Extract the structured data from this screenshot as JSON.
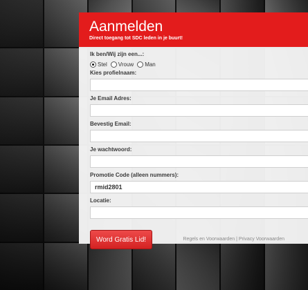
{
  "header": {
    "title": "Aanmelden",
    "subtitle": "Direct toegang tot SDC leden in je buurt!"
  },
  "form": {
    "identity_label": "Ik ben/Wij zijn een...:",
    "identity_options": [
      "Stel",
      "Vrouw",
      "Man"
    ],
    "identity_selected": "Stel",
    "profile_name_label": "Kies profielnaam:",
    "profile_name_value": "",
    "email_label": "Je Email Adres:",
    "email_value": "",
    "confirm_email_label": "Bevestig Email:",
    "confirm_email_value": "",
    "password_label": "Je wachtwoord:",
    "password_value": "",
    "promo_label": "Promotie Code (alleen nummers):",
    "promo_value": "rmid2801",
    "location_label": "Locatie:",
    "location_value": "",
    "submit_label": "Word Gratis Lid!"
  },
  "footer": {
    "terms_link": "Regels en Voorwaarden",
    "separator": "|",
    "privacy_link": "Privacy Voorwaarden"
  },
  "colors": {
    "brand_red": "#e31c1c",
    "panel_bg": "#f5f5f5"
  }
}
